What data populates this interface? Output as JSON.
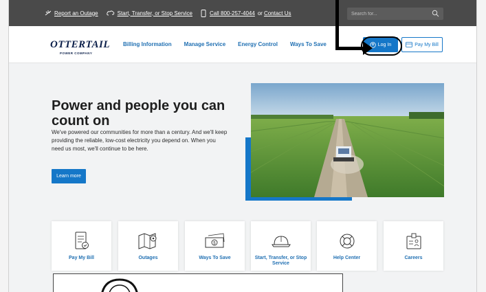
{
  "utility": {
    "report_outage": "Report an Outage",
    "start_transfer": "Start, Transfer, or Stop Service",
    "call": "Call 800-257-4044",
    "or": "or",
    "contact": "Contact Us",
    "search_placeholder": "Search for..."
  },
  "header": {
    "logo_main": "OTTERTAIL",
    "logo_sub": "POWER COMPANY",
    "nav": [
      "Billing Information",
      "Manage Service",
      "Energy Control",
      "Ways To Save"
    ],
    "login": "Log In",
    "pay_bill": "Pay My Bill"
  },
  "hero": {
    "title": "Power and people you can count on",
    "body": "We've powered our communities for more than a century. And we'll keep providing the reliable, low-cost electricity you depend on. When you need us most, we'll continue to be here.",
    "cta": "Learn more"
  },
  "cards": [
    {
      "label": "Pay My Bill",
      "icon": "bill-icon"
    },
    {
      "label": "Outages",
      "icon": "map-icon"
    },
    {
      "label": "Ways To Save",
      "icon": "money-icon"
    },
    {
      "label": "Start, Transfer, or Stop Service",
      "icon": "hardhat-icon"
    },
    {
      "label": "Help Center",
      "icon": "lifebuoy-icon"
    },
    {
      "label": "Careers",
      "icon": "badge-icon"
    }
  ],
  "colors": {
    "accent": "#1577c8",
    "nav_text": "#1f6fb2",
    "utility_bar": "#4a4a4a"
  }
}
